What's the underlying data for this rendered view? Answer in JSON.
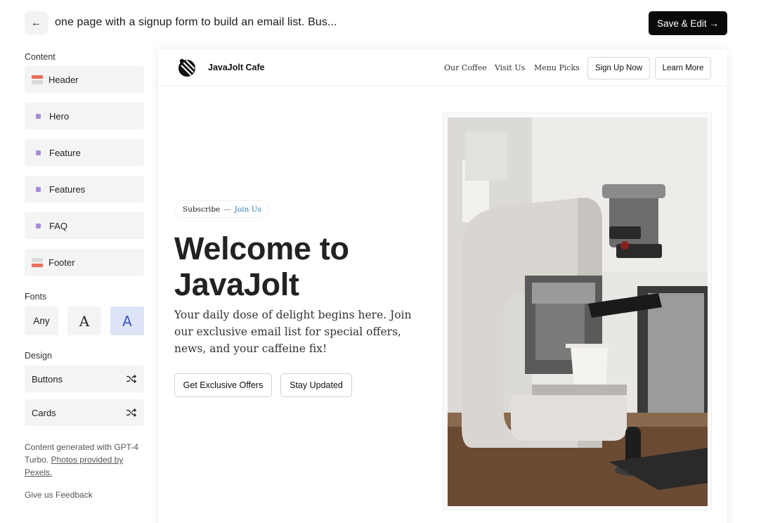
{
  "topbar": {
    "back_icon": "arrow-left-icon",
    "prompt": "one page with a signup form to build an email list. Bus...",
    "save_label": "Save & Edit →"
  },
  "sidebar": {
    "content_label": "Content",
    "content_items": [
      {
        "label": "Header",
        "icon": "header-layout-icon"
      },
      {
        "label": "Hero",
        "icon": "section-dot-icon"
      },
      {
        "label": "Feature",
        "icon": "section-dot-icon"
      },
      {
        "label": "Features",
        "icon": "section-dot-icon"
      },
      {
        "label": "FAQ",
        "icon": "section-dot-icon"
      },
      {
        "label": "Footer",
        "icon": "footer-layout-icon"
      }
    ],
    "fonts_label": "Fonts",
    "font_options": [
      "Any",
      "A",
      "A"
    ],
    "design_label": "Design",
    "design_items": [
      {
        "label": "Buttons",
        "icon": "shuffle-icon"
      },
      {
        "label": "Cards",
        "icon": "shuffle-icon"
      }
    ],
    "credit_text": "Content generated with GPT-4 Turbo.",
    "credit_link": "Photos provided by Pexels.",
    "feedback": "Give us Feedback"
  },
  "site": {
    "brand": "JavaJolt Cafe",
    "nav_links": [
      "Our Coffee",
      "Visit Us",
      "Menu Picks"
    ],
    "nav_buttons": [
      "Sign Up Now",
      "Learn More"
    ],
    "badge_left": "Subscribe",
    "badge_sep": "—",
    "badge_right": "Join Us",
    "hero_title": "Welcome to JavaJolt",
    "hero_subtitle": "Your daily dose of delight begins here. Join our exclusive email list for special offers, news, and your caffeine fix!",
    "cta_buttons": [
      "Get Exclusive Offers",
      "Stay Updated"
    ]
  },
  "colors": {
    "accent_selected": "#dde4f7",
    "accent_text": "#3d56c9",
    "badge_link": "#2f7bb0",
    "swatch_red": "#e8705f",
    "dot_purple": "#a78bdc"
  }
}
